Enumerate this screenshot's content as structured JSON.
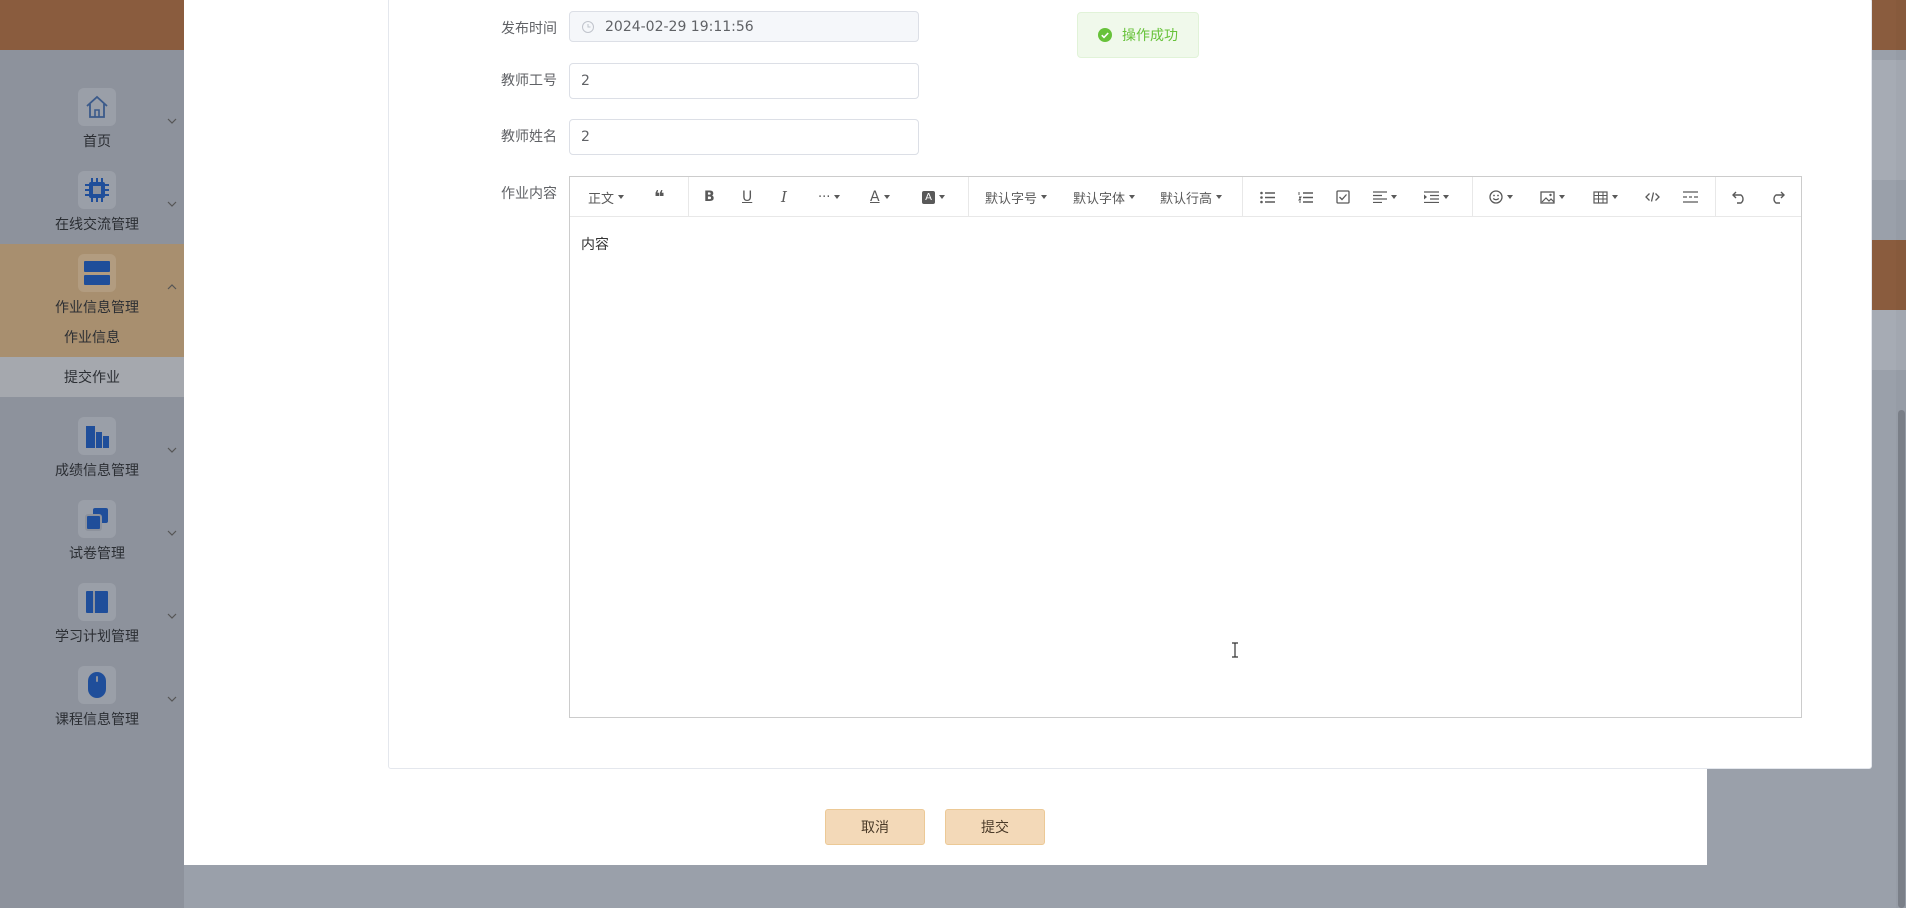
{
  "sidebar": {
    "items": [
      {
        "label": "首页",
        "icon": "home-icon"
      },
      {
        "label": "在线交流管理",
        "icon": "chip-icon"
      },
      {
        "label": "作业信息管理",
        "icon": "layers-icon"
      },
      {
        "label": "成绩信息管理",
        "icon": "buildings-icon"
      },
      {
        "label": "试卷管理",
        "icon": "copy-icon"
      },
      {
        "label": "学习计划管理",
        "icon": "book-icon"
      },
      {
        "label": "课程信息管理",
        "icon": "mouse-icon"
      }
    ],
    "sub_items": [
      {
        "label": "作业信息"
      },
      {
        "label": "提交作业"
      }
    ]
  },
  "form": {
    "publish_time_label": "发布时间",
    "publish_time_value": "2024-02-29 19:11:56",
    "teacher_id_label": "教师工号",
    "teacher_id_value": "2",
    "teacher_name_label": "教师姓名",
    "teacher_name_value": "2",
    "content_label": "作业内容",
    "content_value": "内容"
  },
  "editor_toolbar": {
    "heading": "正文",
    "font_size": "默认字号",
    "font_family": "默认字体",
    "line_height": "默认行高"
  },
  "toast": {
    "message": "操作成功",
    "color": "#67c23a"
  },
  "footer": {
    "cancel_label": "取消",
    "submit_label": "提交"
  },
  "colors": {
    "accent": "#f3d9b8",
    "topbar": "#8a5c3e"
  }
}
